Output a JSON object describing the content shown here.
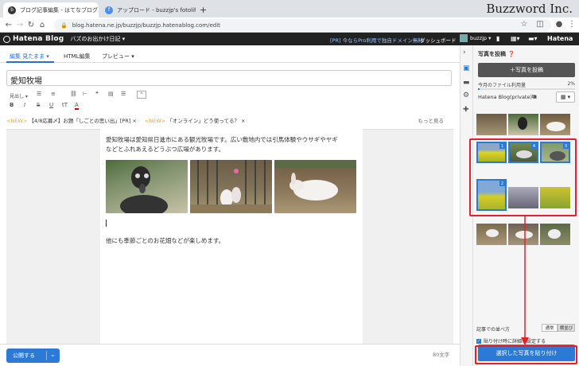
{
  "browser": {
    "tabs": [
      {
        "title": "ブログ記事編集 - はてなブログ",
        "active": true
      },
      {
        "title": "アップロード - buzzjp's fotolife",
        "active": false
      }
    ],
    "new_tab": "+",
    "url": "blog.hatena.ne.jp/buzzjp/buzzjp.hatenablog.com/edit"
  },
  "watermark": "Buzzword Inc.",
  "hatena_bar": {
    "logo": "Hatena Blog",
    "blog_name": "バズのお出かけ日記 ▾",
    "promo": "[PR] 今ならPro利用で独自ドメイン無料",
    "dashboard": "ダッシュボード",
    "user": "buzzjp ▾",
    "brand": "Hatena"
  },
  "editor": {
    "tabs": {
      "edit": "編集 見たまま ▾",
      "html": "HTML編集",
      "preview": "プレビュー ▾"
    },
    "title": "愛知牧場",
    "heading_select": "見出し ▾",
    "news": [
      {
        "tag": "<NEW>",
        "text": "【4/8応募〆】お題「しごとの思い出」[PR]"
      },
      {
        "tag": "<NEW>",
        "text": "「オンライン」どう使ってる？"
      }
    ],
    "more": "もっと見る",
    "body_para1_line1": "愛知牧場は愛知県日進市にある観光牧場です。広い敷地内では引馬体験やウサギやヤギ",
    "body_para1_line2": "などとふれあえるどうぶつ広場があります。",
    "body_para2": "他にも季節ごとのお花畑などが楽しめます。",
    "publish": "公開する",
    "char_count": "80文字"
  },
  "side": {
    "title": "写真を投稿",
    "post_button": "＋写真を投稿",
    "usage_label": "今月のファイル利用量",
    "usage_percent": "2%",
    "usage_fraction": 0.02,
    "album": "Hatena Blog(private) ▾",
    "sort_label": "記事での並べ方",
    "sort_options": [
      "通常",
      "横並び"
    ],
    "checkbox_label": "貼り付け時に詳細を設定する",
    "paste_button": "選択した写真を貼り付け",
    "badges": [
      "1",
      "4",
      "3",
      "2"
    ]
  },
  "colors": {
    "accent": "#2a7ad6",
    "annotation": "#e8202a"
  }
}
